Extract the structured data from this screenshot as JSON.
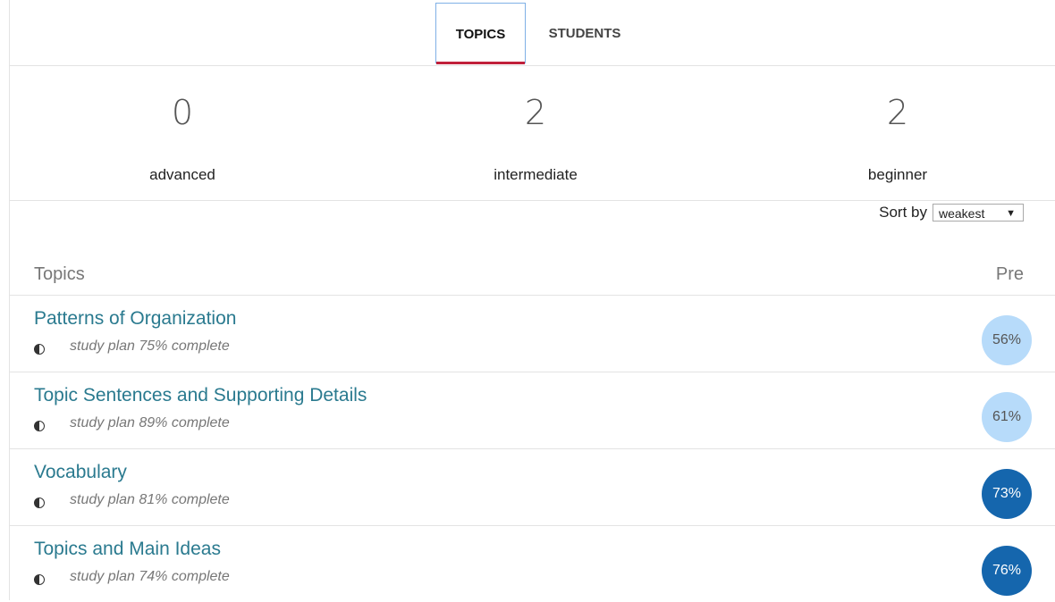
{
  "tabs": [
    {
      "label": "TOPICS",
      "active": true
    },
    {
      "label": "STUDENTS",
      "active": false
    }
  ],
  "levels": [
    {
      "count": "0",
      "label": "advanced"
    },
    {
      "count": "2",
      "label": "intermediate"
    },
    {
      "count": "2",
      "label": "beginner"
    }
  ],
  "sort": {
    "label": "Sort by",
    "selected": "weakest",
    "arrow": "▼"
  },
  "list_header": {
    "topics": "Topics",
    "pre": "Pre"
  },
  "topics": [
    {
      "title": "Patterns of Organization",
      "progress": "study plan 75% complete",
      "score": "56%",
      "score_style": "light"
    },
    {
      "title": "Topic Sentences and Supporting Details",
      "progress": "study plan 89% complete",
      "score": "61%",
      "score_style": "light"
    },
    {
      "title": "Vocabulary",
      "progress": "study plan 81% complete",
      "score": "73%",
      "score_style": "dark"
    },
    {
      "title": "Topics and Main Ideas",
      "progress": "study plan 74% complete",
      "score": "76%",
      "score_style": "dark"
    }
  ],
  "colors": {
    "link": "#2a7a8f",
    "badge_light": "#b7dbfa",
    "badge_dark": "#1566ad",
    "tab_underline": "#c0203a"
  },
  "icons": {
    "progress": "half-circle-icon"
  }
}
